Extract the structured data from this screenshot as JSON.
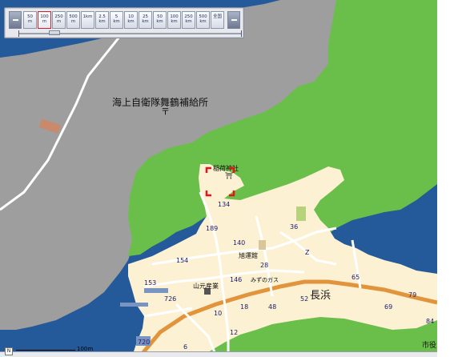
{
  "toolbar": {
    "zoom_out_icon": "minus-icon",
    "zoom_in_icon": "minus-icon",
    "scales": [
      {
        "line1": "50",
        "line2": "m"
      },
      {
        "line1": "100",
        "line2": "m"
      },
      {
        "line1": "250",
        "line2": "m"
      },
      {
        "line1": "500",
        "line2": "m"
      },
      {
        "line1": "1km",
        "line2": ""
      },
      {
        "line1": "2.5",
        "line2": "km"
      },
      {
        "line1": "5",
        "line2": "km"
      },
      {
        "line1": "10",
        "line2": "km"
      },
      {
        "line1": "25",
        "line2": "km"
      },
      {
        "line1": "50",
        "line2": "km"
      },
      {
        "line1": "100",
        "line2": "km"
      },
      {
        "line1": "250",
        "line2": "km"
      },
      {
        "line1": "500",
        "line2": "km"
      },
      {
        "line1": "全国",
        "line2": ""
      }
    ],
    "selected_scale": "100 m"
  },
  "map": {
    "colors": {
      "sea": "#24599a",
      "restricted_area": "#9e9e9e",
      "forest": "#6abf4b",
      "land": "#fcf1d2",
      "major_road": "#e2943c",
      "minor_road": "#ffffff",
      "highlight_marker": "#e3151a"
    },
    "labels": {
      "jmsdf_depot": "海上自衛隊舞鶴補給所",
      "shrine": "稲荷神社",
      "shrine_symbol": "⛩",
      "company_yamamoto": "山元産業",
      "ryokan": "旭運館",
      "gas": "みずのガス",
      "area_nagahama": "長浜",
      "city_office_partial": "市役"
    },
    "block_numbers": [
      "134",
      "189",
      "36",
      "140",
      "28",
      "154",
      "153",
      "146",
      "Z",
      "65",
      "79",
      "726",
      "52",
      "69",
      "10",
      "18",
      "48",
      "84",
      "720",
      "12",
      "6"
    ],
    "scalebar_label": "100m"
  }
}
